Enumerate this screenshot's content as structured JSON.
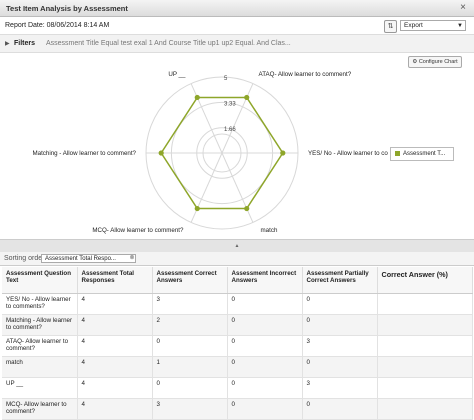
{
  "window": {
    "title": "Test Item Analysis by Assessment",
    "close_label": "×"
  },
  "report": {
    "date_label": "Report Date: 08/06/2014 8:14 AM",
    "export_value": "Export"
  },
  "filters": {
    "toggle": "▶",
    "label": "Filters",
    "summary": "Assessment Title Equal test exal 1 And Course Title up1 up2 Equal. And Clas..."
  },
  "toolbar": {
    "configure_label": "Configure Chart"
  },
  "chart_data": {
    "type": "radar",
    "axes": [
      "UP __",
      "ATAQ- Allow learner to comment?",
      "YES/ No - Allow learner to co",
      "match",
      "MCQ- Allow learner to comment?",
      "Matching - Allow learner to comment?"
    ],
    "radial_ticks": [
      "5",
      "3.33",
      "1.66"
    ],
    "rlim": [
      0,
      5
    ],
    "series": [
      {
        "name": "Assessment T...",
        "values": [
          4,
          4,
          4,
          4,
          4,
          4
        ]
      }
    ],
    "colors": {
      "series": "#8ea62a"
    },
    "legend": "right"
  },
  "sorting": {
    "label": "Sorting order:",
    "chip": "Assessment Total Respo...",
    "remove": "⊗"
  },
  "table": {
    "columns": [
      "Assessment Question Text",
      "Assessment Total Responses",
      "Assessment Correct Answers",
      "Assessment Incorrect Answers",
      "Assessment Partially Correct Answers",
      "Correct Answer (%)"
    ],
    "rows": [
      [
        "YES/ No - Allow learner to comments?",
        "4",
        "3",
        "0",
        "0",
        ""
      ],
      [
        "Matching - Allow learner to comment?",
        "4",
        "2",
        "0",
        "0",
        ""
      ],
      [
        "ATAQ- Allow learner to comment?",
        "4",
        "0",
        "0",
        "3",
        ""
      ],
      [
        "match",
        "4",
        "1",
        "0",
        "0",
        ""
      ],
      [
        "UP __",
        "4",
        "0",
        "0",
        "3",
        ""
      ],
      [
        "MCQ- Allow learner to comment?",
        "4",
        "3",
        "0",
        "0",
        ""
      ]
    ]
  }
}
